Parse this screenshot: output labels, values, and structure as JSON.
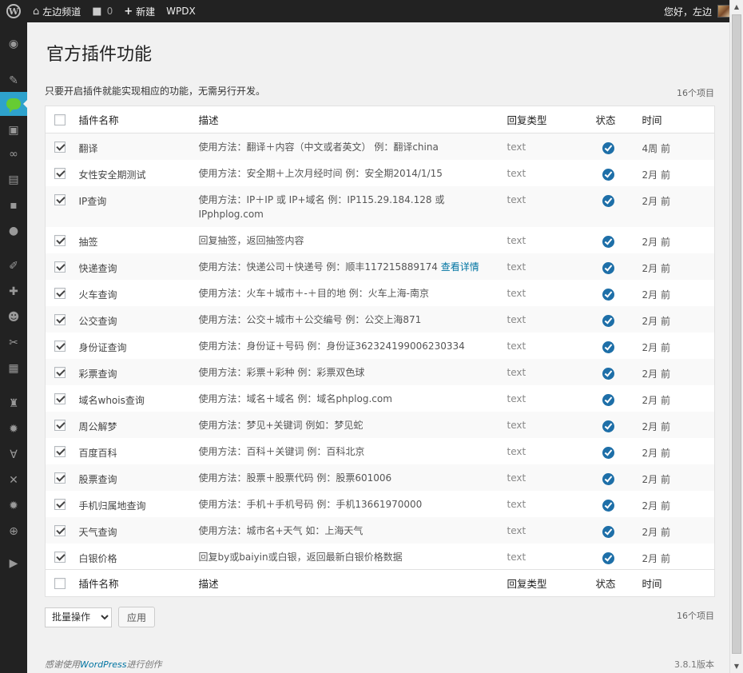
{
  "adminbar": {
    "home_label": "左边频道",
    "comments_count": "0",
    "new_label": "新建",
    "plugin_label": "WPDX",
    "greeting": "您好，左边"
  },
  "page": {
    "title": "官方插件功能",
    "intro": "只要开启插件就能实现相应的功能，无需另行开发。",
    "item_count_top": "16个项目",
    "item_count_bottom": "16个项目"
  },
  "table": {
    "columns": {
      "name": "插件名称",
      "description": "描述",
      "reply_type": "回复类型",
      "status": "状态",
      "time": "时间"
    },
    "rows": [
      {
        "name": "翻译",
        "description": "使用方法：翻译＋内容（中文或者英文）  例：翻译china",
        "more_link": "",
        "reply_type": "text",
        "time": "4周 前",
        "checked": true
      },
      {
        "name": "女性安全期测试",
        "description": "使用方法：安全期＋上次月经时间  例：安全期2014/1/15",
        "more_link": "",
        "reply_type": "text",
        "time": "2月 前",
        "checked": true
      },
      {
        "name": "IP查询",
        "description": "使用方法：IP＋IP 或 IP+域名  例：IP115.29.184.128 或 IPphplog.com",
        "more_link": "",
        "reply_type": "text",
        "time": "2月 前",
        "checked": true
      },
      {
        "name": "抽签",
        "description": "回复抽签，返回抽签内容",
        "more_link": "",
        "reply_type": "text",
        "time": "2月 前",
        "checked": true
      },
      {
        "name": "快递查询",
        "description": "使用方法：快递公司＋快递号  例：顺丰117215889174 ",
        "more_link": "查看详情",
        "reply_type": "text",
        "time": "2月 前",
        "checked": true
      },
      {
        "name": "火车查询",
        "description": "使用方法：火车＋城市＋-＋目的地  例：火车上海-南京",
        "more_link": "",
        "reply_type": "text",
        "time": "2月 前",
        "checked": true
      },
      {
        "name": "公交查询",
        "description": "使用方法：公交＋城市＋公交编号  例：公交上海871",
        "more_link": "",
        "reply_type": "text",
        "time": "2月 前",
        "checked": true
      },
      {
        "name": "身份证查询",
        "description": "使用方法：身份证＋号码  例：身份证362324199006230334",
        "more_link": "",
        "reply_type": "text",
        "time": "2月 前",
        "checked": true
      },
      {
        "name": "彩票查询",
        "description": "使用方法：彩票＋彩种  例：彩票双色球",
        "more_link": "",
        "reply_type": "text",
        "time": "2月 前",
        "checked": true
      },
      {
        "name": "域名whois查询",
        "description": "使用方法：域名＋域名  例：域名phplog.com",
        "more_link": "",
        "reply_type": "text",
        "time": "2月 前",
        "checked": true
      },
      {
        "name": "周公解梦",
        "description": "使用方法：梦见+关键词  例如：梦见蛇",
        "more_link": "",
        "reply_type": "text",
        "time": "2月 前",
        "checked": true
      },
      {
        "name": "百度百科",
        "description": "使用方法：百科＋关键词  例：百科北京",
        "more_link": "",
        "reply_type": "text",
        "time": "2月 前",
        "checked": true
      },
      {
        "name": "股票查询",
        "description": "使用方法：股票＋股票代码  例：股票601006",
        "more_link": "",
        "reply_type": "text",
        "time": "2月 前",
        "checked": true
      },
      {
        "name": "手机归属地查询",
        "description": "使用方法：手机＋手机号码  例：手机13661970000",
        "more_link": "",
        "reply_type": "text",
        "time": "2月 前",
        "checked": true
      },
      {
        "name": "天气查询",
        "description": "使用方法：城市名+天气  如：上海天气",
        "more_link": "",
        "reply_type": "text",
        "time": "2月 前",
        "checked": true
      },
      {
        "name": "白银价格",
        "description": "回复by或baiyin或白银，返回最新白银价格数据",
        "more_link": "",
        "reply_type": "text",
        "time": "2月 前",
        "checked": true
      }
    ]
  },
  "bulk": {
    "select_label": "批量操作",
    "apply_label": "应用"
  },
  "footer": {
    "thanks_prefix": "感谢使用",
    "wordpress_link": "WordPress",
    "thanks_suffix": "进行创作",
    "version": "3.8.1版本"
  },
  "colors": {
    "adminbar_bg": "#222222",
    "menu_current": "#2ea2cc",
    "status_icon": "#1e6fa8",
    "link": "#0074a2"
  },
  "icons": {
    "menu": [
      "dashboard-icon",
      "pin-icon",
      "chat-bubble-icon",
      "media-icon",
      "links-icon",
      "pages-icon",
      "comments-icon",
      "feedback-icon",
      "appearance-icon",
      "plugins-icon",
      "users-icon",
      "tools-icon",
      "import-icon",
      "spy-icon",
      "settings-icon",
      "custom-icon",
      "tools-x-icon",
      "settings-2-icon",
      "globe-icon",
      "play-icon"
    ]
  }
}
